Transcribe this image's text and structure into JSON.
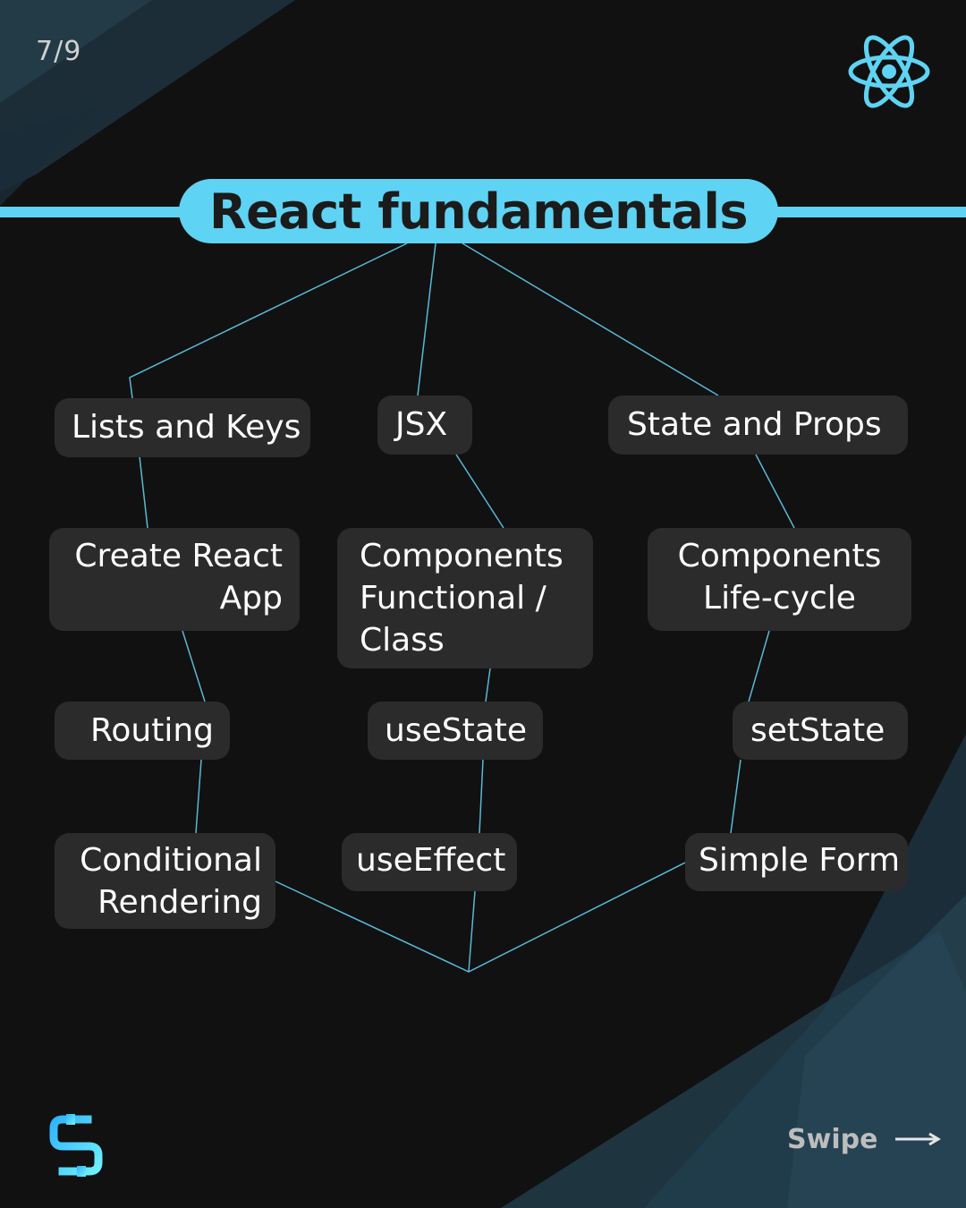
{
  "slide_counter": "7/9",
  "title": "React fundamentals",
  "nodes": {
    "lists_and_keys": "Lists and Keys",
    "jsx": "JSX",
    "state_and_props": "State and Props",
    "create_react_app": "Create React\nApp",
    "components_functional_class": "Components\nFunctional /\nClass",
    "components_life_cycle": "Components\nLife-cycle",
    "routing": "Routing",
    "use_state": "useState",
    "set_state": "setState",
    "conditional_rendering": "Conditional\nRendering",
    "use_effect": "useEffect",
    "simple_form": "Simple Form"
  },
  "footer": {
    "swipe_label": "Swipe"
  },
  "icons": {
    "top_right": "react-atom-icon",
    "bottom_left": "brand-s-logo-icon",
    "swipe": "arrow-right-icon"
  },
  "colors": {
    "accent": "#5fd3f3",
    "background": "#111111",
    "node_fill": "#2b2b2b",
    "connector": "#5ab8d6",
    "title_text": "#1b1b1b"
  }
}
